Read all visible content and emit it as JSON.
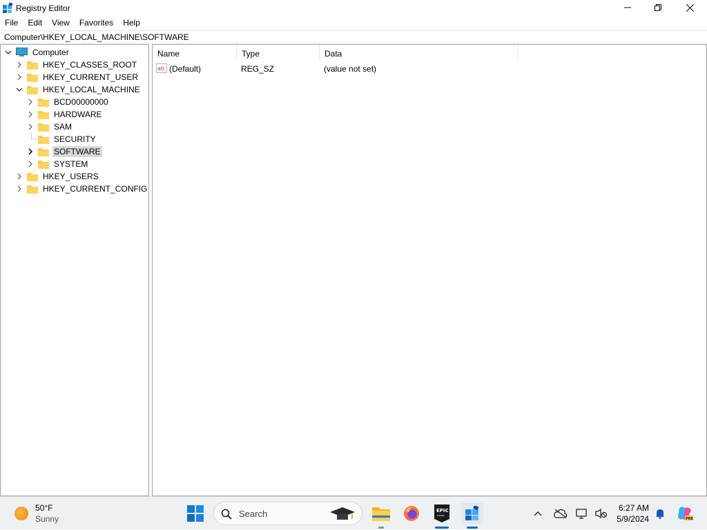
{
  "window": {
    "title": "Registry Editor",
    "minimize_icon": "minimize-icon",
    "maximize_icon": "restore-icon",
    "close_icon": "close-icon"
  },
  "menu": [
    "File",
    "Edit",
    "View",
    "Favorites",
    "Help"
  ],
  "address": "Computer\\HKEY_LOCAL_MACHINE\\SOFTWARE",
  "tree": {
    "root": "Computer",
    "hives": {
      "classes_root": "HKEY_CLASSES_ROOT",
      "current_user": "HKEY_CURRENT_USER",
      "local_machine": "HKEY_LOCAL_MACHINE",
      "users": "HKEY_USERS",
      "current_config": "HKEY_CURRENT_CONFIG"
    },
    "local_machine_children": [
      "BCD00000000",
      "HARDWARE",
      "SAM",
      "SECURITY",
      "SOFTWARE",
      "SYSTEM"
    ],
    "selected": "SOFTWARE"
  },
  "list": {
    "columns": [
      "Name",
      "Type",
      "Data"
    ],
    "rows": [
      {
        "name": "(Default)",
        "type": "REG_SZ",
        "data": "(value not set)",
        "icon": "string-value-icon"
      }
    ]
  },
  "taskbar": {
    "weather": {
      "temp": "50°F",
      "condition": "Sunny"
    },
    "search_placeholder": "Search",
    "time": "6:27 AM",
    "date": "5/9/2024",
    "accent": "#0067c0",
    "folder_color": "#f7c948"
  }
}
